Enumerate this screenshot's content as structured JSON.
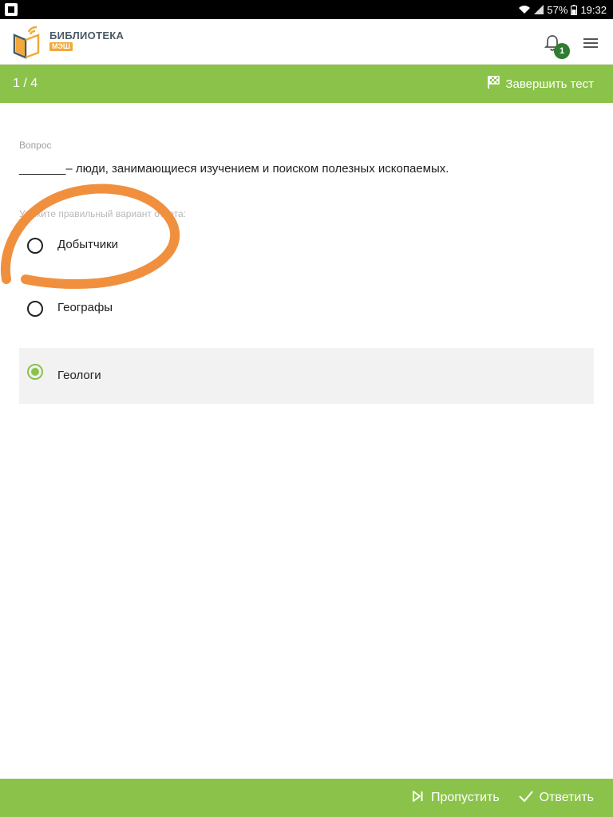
{
  "status_bar": {
    "battery": "57%",
    "time": "19:32"
  },
  "header": {
    "logo_title": "БИБЛИОТЕКА",
    "logo_sub": "МЭШ",
    "notification_count": "1"
  },
  "test_bar": {
    "progress": "1 / 4",
    "finish_label": "Завершить тест"
  },
  "question": {
    "label": "Вопрос",
    "text": "_______– люди, занимающиеся изучением и поиском полезных ископаемых.",
    "instruction": "Укажите правильный вариант ответа:",
    "options": [
      {
        "label": "Добытчики",
        "selected": false
      },
      {
        "label": "Географы",
        "selected": false
      },
      {
        "label": "Геологи",
        "selected": true
      }
    ]
  },
  "footer": {
    "skip_label": "Пропустить",
    "answer_label": "Ответить"
  },
  "colors": {
    "accent": "#8bc34a",
    "badge": "#2e7d32",
    "scribble": "#f0903f",
    "logo_orange": "#f0a93a"
  }
}
